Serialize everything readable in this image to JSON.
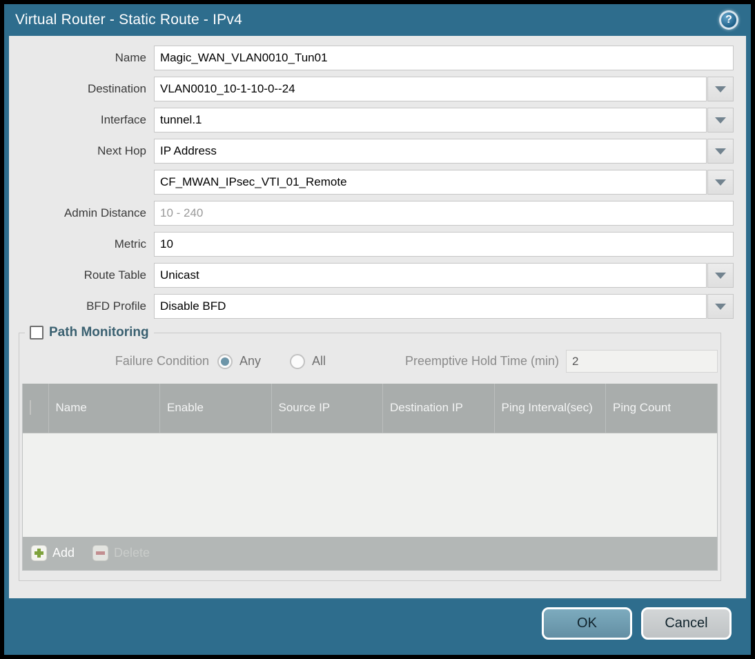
{
  "dialog": {
    "title": "Virtual Router - Static Route - IPv4",
    "help_icon": "question-mark",
    "accent_color": "#2e6d8d"
  },
  "fields": {
    "name": {
      "label": "Name",
      "value": "Magic_WAN_VLAN0010_Tun01"
    },
    "destination": {
      "label": "Destination",
      "value": "VLAN0010_10-1-10-0--24"
    },
    "interface": {
      "label": "Interface",
      "value": "tunnel.1"
    },
    "next_hop": {
      "label": "Next Hop",
      "value": "IP Address"
    },
    "next_hop_address": {
      "value": "CF_MWAN_IPsec_VTI_01_Remote"
    },
    "admin_distance": {
      "label": "Admin Distance",
      "value": "",
      "placeholder": "10 - 240"
    },
    "metric": {
      "label": "Metric",
      "value": "10"
    },
    "route_table": {
      "label": "Route Table",
      "value": "Unicast"
    },
    "bfd_profile": {
      "label": "BFD Profile",
      "value": "Disable BFD"
    }
  },
  "path_monitoring": {
    "title": "Path Monitoring",
    "checkbox_checked": false,
    "failure_condition_label": "Failure Condition",
    "option_any": {
      "label": "Any",
      "selected": true
    },
    "option_all": {
      "label": "All",
      "selected": false
    },
    "preemptive_label": "Preemptive Hold Time (min)",
    "preemptive_value": "2",
    "table_headers": [
      "Name",
      "Enable",
      "Source IP",
      "Destination IP",
      "Ping Interval(sec)",
      "Ping Count"
    ],
    "table_rows": [],
    "add_label": "Add",
    "delete_label": "Delete",
    "delete_enabled": false
  },
  "footer": {
    "ok_label": "OK",
    "cancel_label": "Cancel"
  },
  "colors": {
    "titlebar": "#2e6d8d",
    "body": "#e9e9e9",
    "table_header": "#a9adac",
    "ok_button": "#6fa0b4",
    "add_plus": "#7ea23c",
    "delete_minus": "#c88184"
  }
}
